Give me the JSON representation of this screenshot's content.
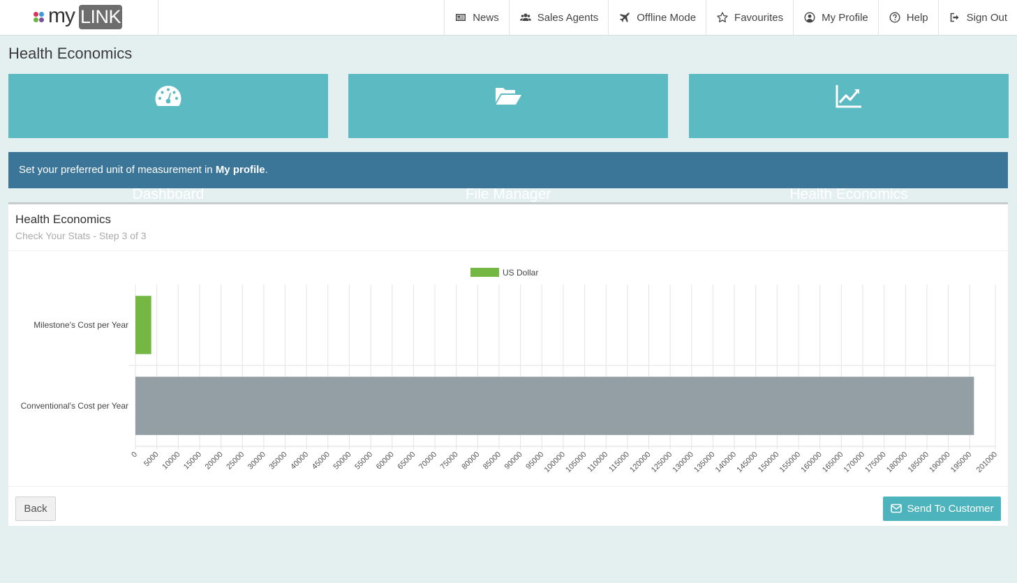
{
  "app": {
    "logo_text_my": "my",
    "logo_text_link": "LINK",
    "logo_colors": [
      "#d9365a",
      "#3b9cd9",
      "#6cb33f",
      "#7a4f9a"
    ]
  },
  "nav": {
    "items": [
      {
        "label": "News",
        "icon": "newspaper-icon"
      },
      {
        "label": "Sales Agents",
        "icon": "users-icon"
      },
      {
        "label": "Offline Mode",
        "icon": "plane-icon"
      },
      {
        "label": "Favourites",
        "icon": "star-icon"
      },
      {
        "label": "My Profile",
        "icon": "user-circle-icon"
      },
      {
        "label": "Help",
        "icon": "question-circle-icon"
      },
      {
        "label": "Sign Out",
        "icon": "sign-out-icon"
      }
    ]
  },
  "page": {
    "title": "Health Economics"
  },
  "tiles": [
    {
      "label": "Dashboard",
      "icon": "dashboard-gauge-icon"
    },
    {
      "label": "File Manager",
      "icon": "folder-open-icon"
    },
    {
      "label": "Health Economics",
      "icon": "line-chart-icon"
    }
  ],
  "alert": {
    "text_before": "Set your preferred unit of measurement in ",
    "link_text": "My profile",
    "text_after": "."
  },
  "panel": {
    "title": "Health Economics",
    "subtitle": "Check Your Stats - Step 3 of 3",
    "back_label": "Back",
    "send_label": "Send To Customer"
  },
  "colors": {
    "accent": "#5bbac2",
    "alert": "#3b7699",
    "milestone_bar": "#74b843",
    "conventional_bar": "#949fa5"
  },
  "chart_data": {
    "type": "bar",
    "orientation": "horizontal",
    "legend": [
      {
        "label": "US Dollar",
        "color": "#74b843"
      }
    ],
    "legend_position": "top-center",
    "categories": [
      "Milestone's Cost per Year",
      "Conventional's Cost per Year"
    ],
    "values": [
      3700,
      196000
    ],
    "bar_colors": [
      "#74b843",
      "#949fa5"
    ],
    "xlim": [
      0,
      201000
    ],
    "x_ticks": [
      "0",
      "5000",
      "10000",
      "15000",
      "20000",
      "25000",
      "30000",
      "35000",
      "40000",
      "45000",
      "50000",
      "55000",
      "60000",
      "65000",
      "70000",
      "75000",
      "80000",
      "85000",
      "90000",
      "95000",
      "100000",
      "105000",
      "110000",
      "115000",
      "120000",
      "125000",
      "130000",
      "135000",
      "140000",
      "145000",
      "150000",
      "155000",
      "160000",
      "165000",
      "170000",
      "175000",
      "180000",
      "185000",
      "190000",
      "195000",
      "201000"
    ],
    "x_tick_values": [
      0,
      5000,
      10000,
      15000,
      20000,
      25000,
      30000,
      35000,
      40000,
      45000,
      50000,
      55000,
      60000,
      65000,
      70000,
      75000,
      80000,
      85000,
      90000,
      95000,
      100000,
      105000,
      110000,
      115000,
      120000,
      125000,
      130000,
      135000,
      140000,
      145000,
      150000,
      155000,
      160000,
      165000,
      170000,
      175000,
      180000,
      185000,
      190000,
      195000,
      201000
    ],
    "grid": true
  }
}
